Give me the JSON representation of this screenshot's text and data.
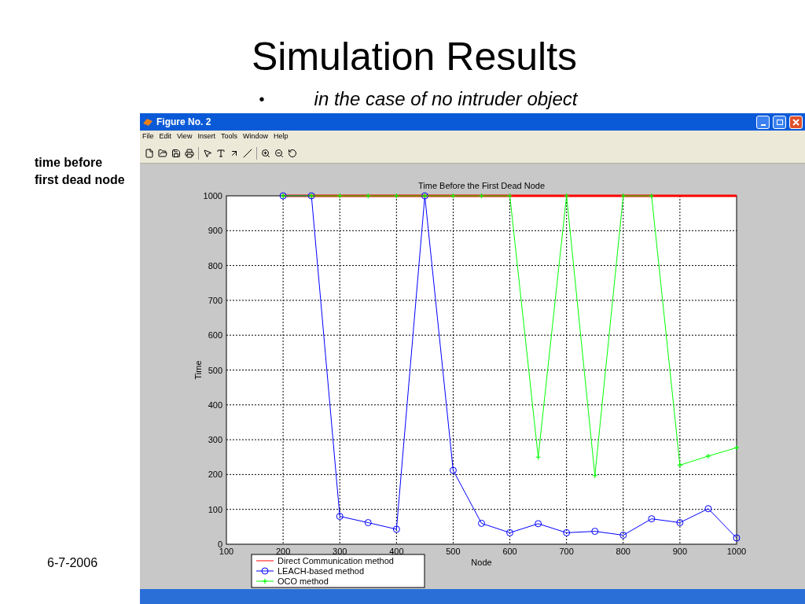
{
  "slide": {
    "title": "Simulation Results",
    "bullet": "•",
    "bullet_text": "in the case of no intruder object",
    "side_note": "time before first dead node",
    "date": "6-7-2006"
  },
  "window": {
    "title": "Figure No. 2",
    "menu": [
      "File",
      "Edit",
      "View",
      "Insert",
      "Tools",
      "Window",
      "Help"
    ]
  },
  "chart_data": {
    "type": "line",
    "title": "Time Before the First Dead Node",
    "xlabel": "Node",
    "ylabel": "Time",
    "x": [
      200,
      250,
      300,
      350,
      400,
      450,
      500,
      550,
      600,
      650,
      700,
      750,
      800,
      850,
      900,
      950,
      1000
    ],
    "xlim": [
      100,
      1000
    ],
    "ylim": [
      0,
      1000
    ],
    "xticks": [
      100,
      200,
      300,
      400,
      500,
      600,
      700,
      800,
      900,
      1000
    ],
    "yticks": [
      0,
      100,
      200,
      300,
      400,
      500,
      600,
      700,
      800,
      900,
      1000
    ],
    "grid": true,
    "legend": true,
    "series": [
      {
        "name": "Direct Communication method",
        "color": "#ff0000",
        "marker": "none",
        "values": [
          1000,
          1000,
          1000,
          1000,
          1000,
          1000,
          1000,
          1000,
          1000,
          1000,
          1000,
          1000,
          1000,
          1000,
          1000,
          1000,
          1000
        ]
      },
      {
        "name": "LEACH-based method",
        "color": "#0000ff",
        "marker": "circle",
        "values": [
          1000,
          1000,
          80,
          62,
          43,
          1000,
          212,
          60,
          33,
          59,
          33,
          37,
          26,
          73,
          62,
          102,
          18
        ]
      },
      {
        "name": "OCO method",
        "color": "#00ff00",
        "marker": "plus",
        "values": [
          1000,
          1000,
          1000,
          1000,
          1000,
          1000,
          1000,
          1000,
          1000,
          250,
          1000,
          197,
          1000,
          1000,
          227,
          253,
          277
        ]
      }
    ]
  }
}
